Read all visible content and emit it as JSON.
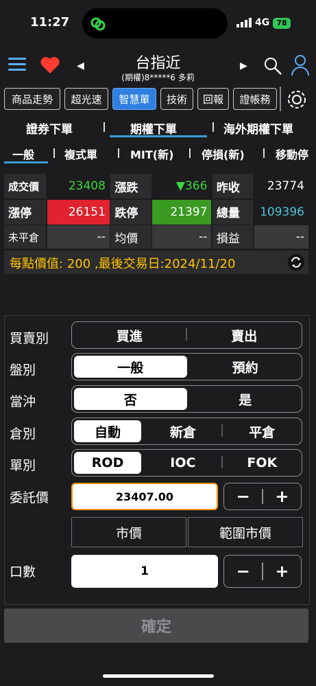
{
  "status": {
    "time": "11:27",
    "network": "4G",
    "battery": "78"
  },
  "header": {
    "title": "台指近",
    "subtitle": "(期權)8*****6  多莉"
  },
  "toolbar": [
    "商品走勢",
    "超光速",
    "智慧單",
    "技術",
    "回報",
    "證帳務"
  ],
  "order_tabs": [
    "證券下單",
    "期權下單",
    "海外期權下單"
  ],
  "sub_tabs": [
    "一般",
    "複式單",
    "MIT(新)",
    "停損(新)",
    "移動停"
  ],
  "quote": {
    "row1": {
      "l1": "成交價",
      "v1": "23408",
      "l2": "漲跌",
      "v2": "▼366",
      "l3": "昨收",
      "v3": "23774"
    },
    "row2": {
      "l1": "漲停",
      "v1": "26151",
      "l2": "跌停",
      "v2": "21397",
      "l3": "總量",
      "v3": "109396"
    },
    "row3": {
      "l1": "未平倉",
      "v1": "--",
      "l2": "均價",
      "v2": "--",
      "l3": "損益",
      "v3": "--"
    }
  },
  "info": "每點價值: 200 ,最後交易日:2024/11/20",
  "form": {
    "side_label": "買賣別",
    "side": [
      "買進",
      "賣出"
    ],
    "session_label": "盤別",
    "session": [
      "一般",
      "預約"
    ],
    "daytrade_label": "當沖",
    "daytrade": [
      "否",
      "是"
    ],
    "position_label": "倉別",
    "position": [
      "自動",
      "新倉",
      "平倉"
    ],
    "type_label": "單別",
    "type": [
      "ROD",
      "IOC",
      "FOK"
    ],
    "price_label": "委託價",
    "price_value": "23407.00",
    "market_btn": "市價",
    "range_market_btn": "範圍市價",
    "qty_label": "口數",
    "qty_value": "1",
    "minus": "−",
    "plus": "+"
  },
  "confirm": "確定",
  "colors": {
    "up": "#e0232e",
    "down": "#3cb021",
    "accent": "#2f7fe0",
    "warn": "#ffc400",
    "cyan": "#4fc3d9"
  }
}
